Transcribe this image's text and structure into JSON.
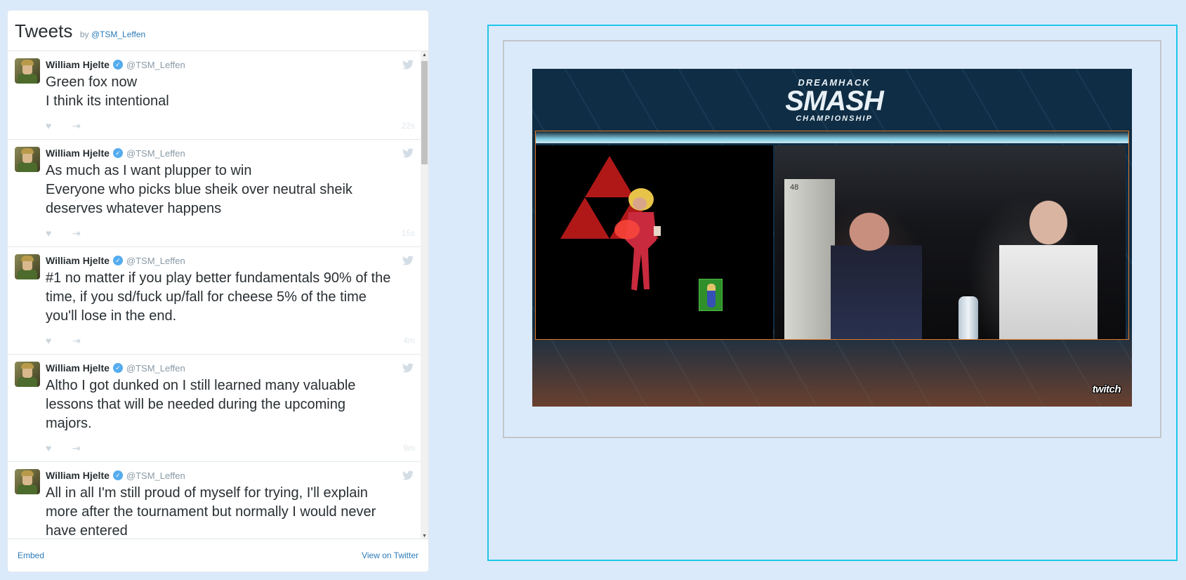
{
  "widget": {
    "title": "Tweets",
    "by_prefix": "by",
    "by_handle": "@TSM_Leffen",
    "footer": {
      "embed": "Embed",
      "view_on_twitter": "View on Twitter"
    }
  },
  "tweets": [
    {
      "author": "William Hjelte",
      "handle": "@TSM_Leffen",
      "text": "Green fox now\nI think its intentional",
      "time": "22s"
    },
    {
      "author": "William Hjelte",
      "handle": "@TSM_Leffen",
      "text": "As much as I want plupper to win\nEveryone who picks blue sheik over neutral sheik\ndeserves whatever happens",
      "time": "15s"
    },
    {
      "author": "William Hjelte",
      "handle": "@TSM_Leffen",
      "text": "#1 no matter if you play better fundamentals 90% of the\ntime, if you sd/fuck up/fall for cheese 5% of the time\nyou'll lose in the end.",
      "time": "4m"
    },
    {
      "author": "William Hjelte",
      "handle": "@TSM_Leffen",
      "text": "Altho I got dunked on I still learned many valuable\nlessons that will be needed during the upcoming\nmajors.",
      "time": "9m"
    },
    {
      "author": "William Hjelte",
      "handle": "@TSM_Leffen",
      "text": "All in all I'm still proud of myself for trying, I'll explain\nmore after the tournament but normally I would never\nhave entered",
      "time": ""
    }
  ],
  "video": {
    "logo_top": "DREAMHACK",
    "logo_main": "SMASH",
    "logo_bottom": "CHAMPIONSHIP",
    "cam_sign": "48",
    "twitch": "twitch"
  },
  "colors": {
    "page_bg": "#dbeafb",
    "link": "#2b7bb9",
    "frame_outer": "#1ec7e8",
    "frame_inner": "#c2c6ca",
    "game_border": "#e47a25"
  }
}
